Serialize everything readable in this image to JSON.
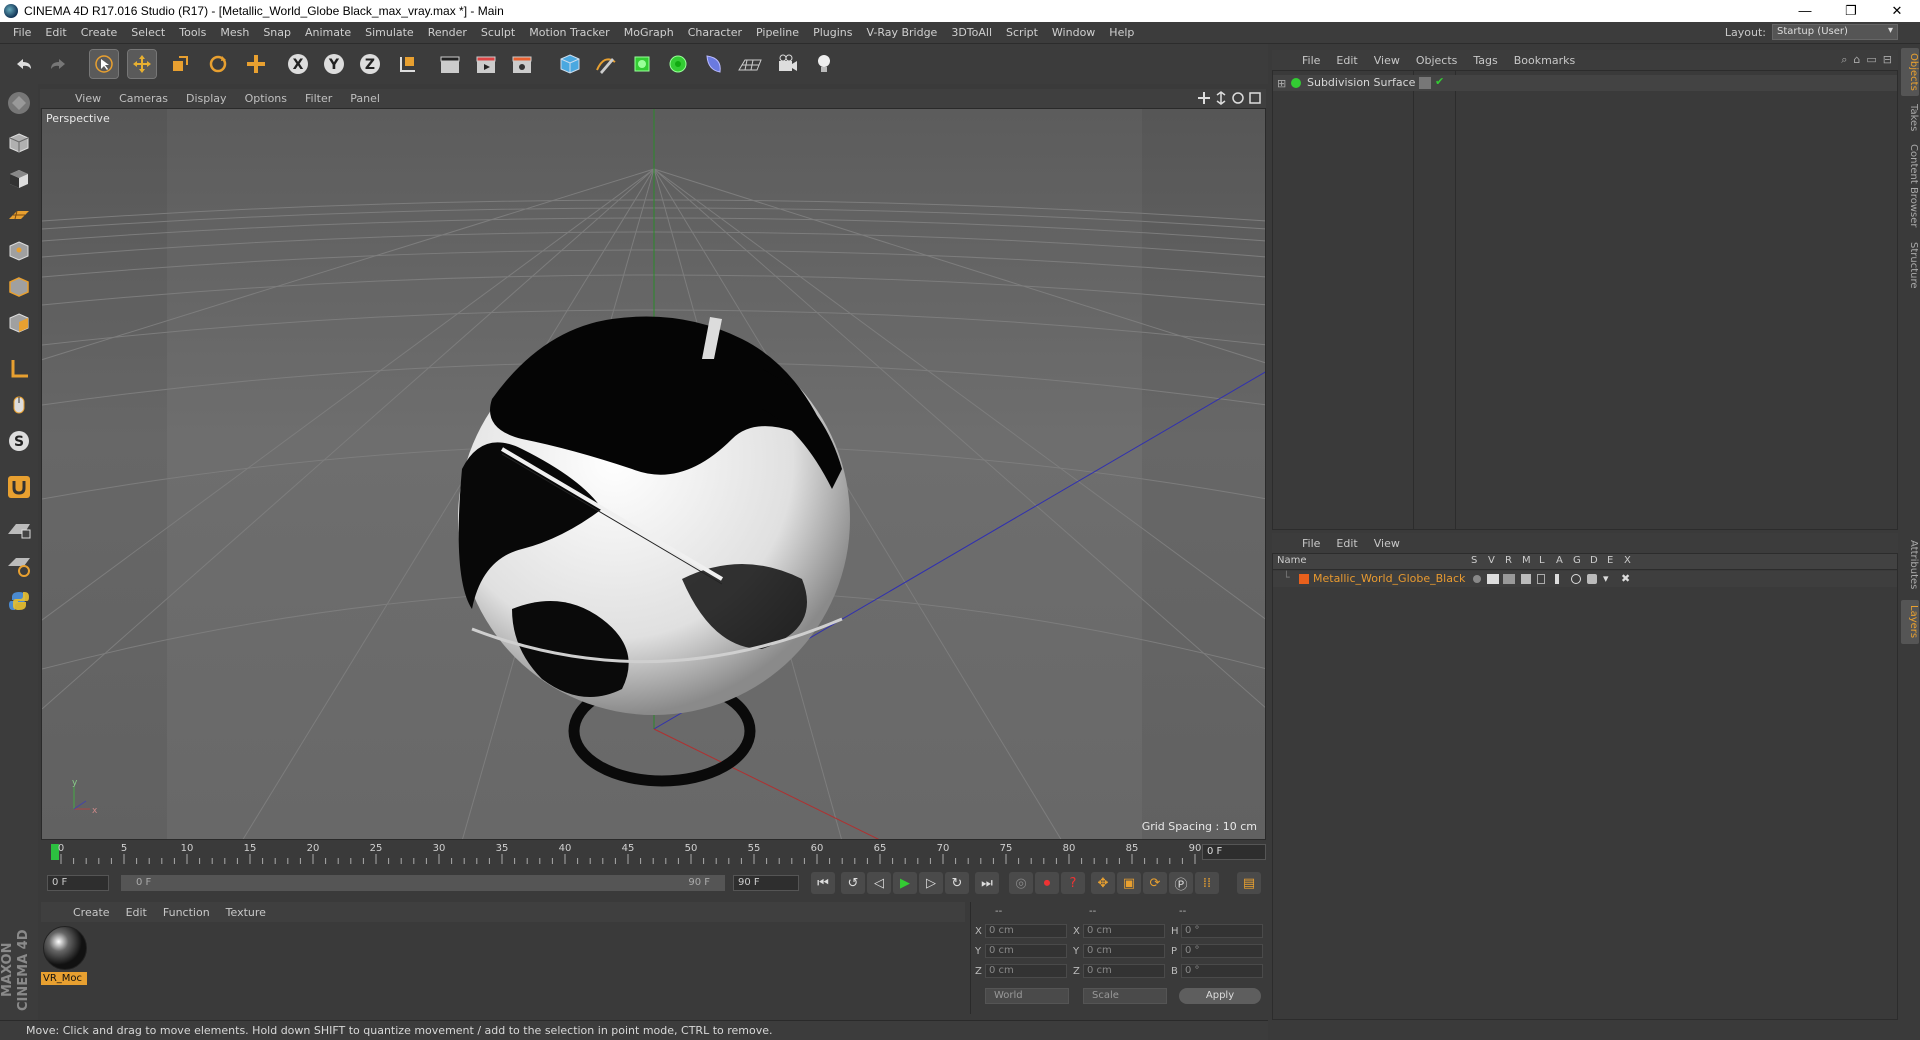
{
  "window": {
    "title": "CINEMA 4D R17.016 Studio (R17) - [Metallic_World_Globe Black_max_vray.max *] - Main",
    "controls": [
      "—",
      "❐",
      "✕"
    ]
  },
  "menubar": {
    "items": [
      "File",
      "Edit",
      "Create",
      "Select",
      "Tools",
      "Mesh",
      "Snap",
      "Animate",
      "Simulate",
      "Render",
      "Sculpt",
      "Motion Tracker",
      "MoGraph",
      "Character",
      "Pipeline",
      "Plugins",
      "V-Ray Bridge",
      "3DToAll",
      "Script",
      "Window",
      "Help"
    ],
    "layout_label": "Layout:",
    "layout_value": "Startup (User)"
  },
  "viewport": {
    "menu": [
      "View",
      "Cameras",
      "Display",
      "Options",
      "Filter",
      "Panel"
    ],
    "camera_label": "Perspective",
    "grid_spacing": "Grid Spacing : 10 cm",
    "accent": "#2a8a2a"
  },
  "timeline": {
    "ticks": [
      "0",
      "5",
      "10",
      "15",
      "20",
      "25",
      "30",
      "35",
      "40",
      "45",
      "50",
      "55",
      "60",
      "65",
      "70",
      "75",
      "80",
      "85",
      "90"
    ],
    "current_frame": "0 F"
  },
  "transport": {
    "start_field": "0 F",
    "range_start": "0 F",
    "range_end": "90 F",
    "end_field": "90 F"
  },
  "materials": {
    "menu": [
      "Create",
      "Edit",
      "Function",
      "Texture"
    ],
    "items": [
      {
        "name": "VR_Moc"
      }
    ]
  },
  "coordinates": {
    "headers": [
      "--",
      "--",
      "--"
    ],
    "rows": [
      {
        "a": "X",
        "a_val": "0 cm",
        "b": "X",
        "b_val": "0 cm",
        "c": "H",
        "c_val": "0 °"
      },
      {
        "a": "Y",
        "a_val": "0 cm",
        "b": "Y",
        "b_val": "0 cm",
        "c": "P",
        "c_val": "0 °"
      },
      {
        "a": "Z",
        "a_val": "0 cm",
        "b": "Z",
        "b_val": "0 cm",
        "c": "B",
        "c_val": "0 °"
      }
    ],
    "dropdown_world": "World",
    "dropdown_scale": "Scale",
    "apply_label": "Apply"
  },
  "status": {
    "text": "Move: Click and drag to move elements. Hold down SHIFT to quantize movement / add to the selection in point mode, CTRL to remove."
  },
  "objects_panel": {
    "menu": [
      "File",
      "Edit",
      "View",
      "Objects",
      "Tags",
      "Bookmarks"
    ],
    "items": [
      {
        "name": "Subdivision Surface"
      }
    ]
  },
  "layers_panel": {
    "menu": [
      "File",
      "Edit",
      "View"
    ],
    "columns": [
      "Name",
      "S",
      "V",
      "R",
      "M",
      "L",
      "A",
      "G",
      "D",
      "E",
      "X"
    ],
    "items": [
      {
        "name": "Metallic_World_Globe_Black",
        "color": "#e8601c"
      }
    ]
  },
  "side_tabs": [
    "Objects",
    "Takes",
    "Content Browser",
    "Structure",
    "Attributes",
    "Layers"
  ],
  "maxon_logo": "MAXON CINEMA 4D"
}
